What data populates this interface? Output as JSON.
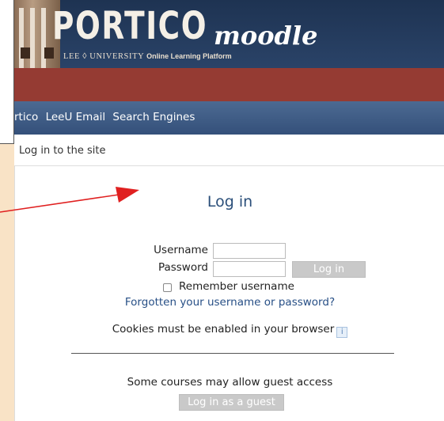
{
  "banner": {
    "logo_main": "PORTICO",
    "logo_moodle": "moodle",
    "logo_sub_left": "LEE",
    "logo_sub_mid": "UNIVERSITY",
    "logo_sub_right": "Online Learning Platform"
  },
  "nav": {
    "items": [
      "rtico",
      "LeeU Email",
      "Search Engines"
    ]
  },
  "breadcrumb": "Log in to the site",
  "login": {
    "title": "Log in",
    "username_label": "Username",
    "password_label": "Password",
    "username_value": "",
    "password_value": "",
    "login_button": "Log in",
    "remember_label": "Remember username",
    "remember_checked": false,
    "forgot_link": "Forgotten your username or password?",
    "cookies_text": "Cookies must be enabled in your browser",
    "info_icon": "info-icon",
    "guest_text": "Some courses may allow guest access",
    "guest_button": "Log in as a guest"
  },
  "colors": {
    "banner": "#2a4368",
    "red_band": "#953b33",
    "navbar": "#3c5a84",
    "title": "#2b4f7a",
    "arrow": "#e02020",
    "backdrop": "#f9e3c6"
  }
}
